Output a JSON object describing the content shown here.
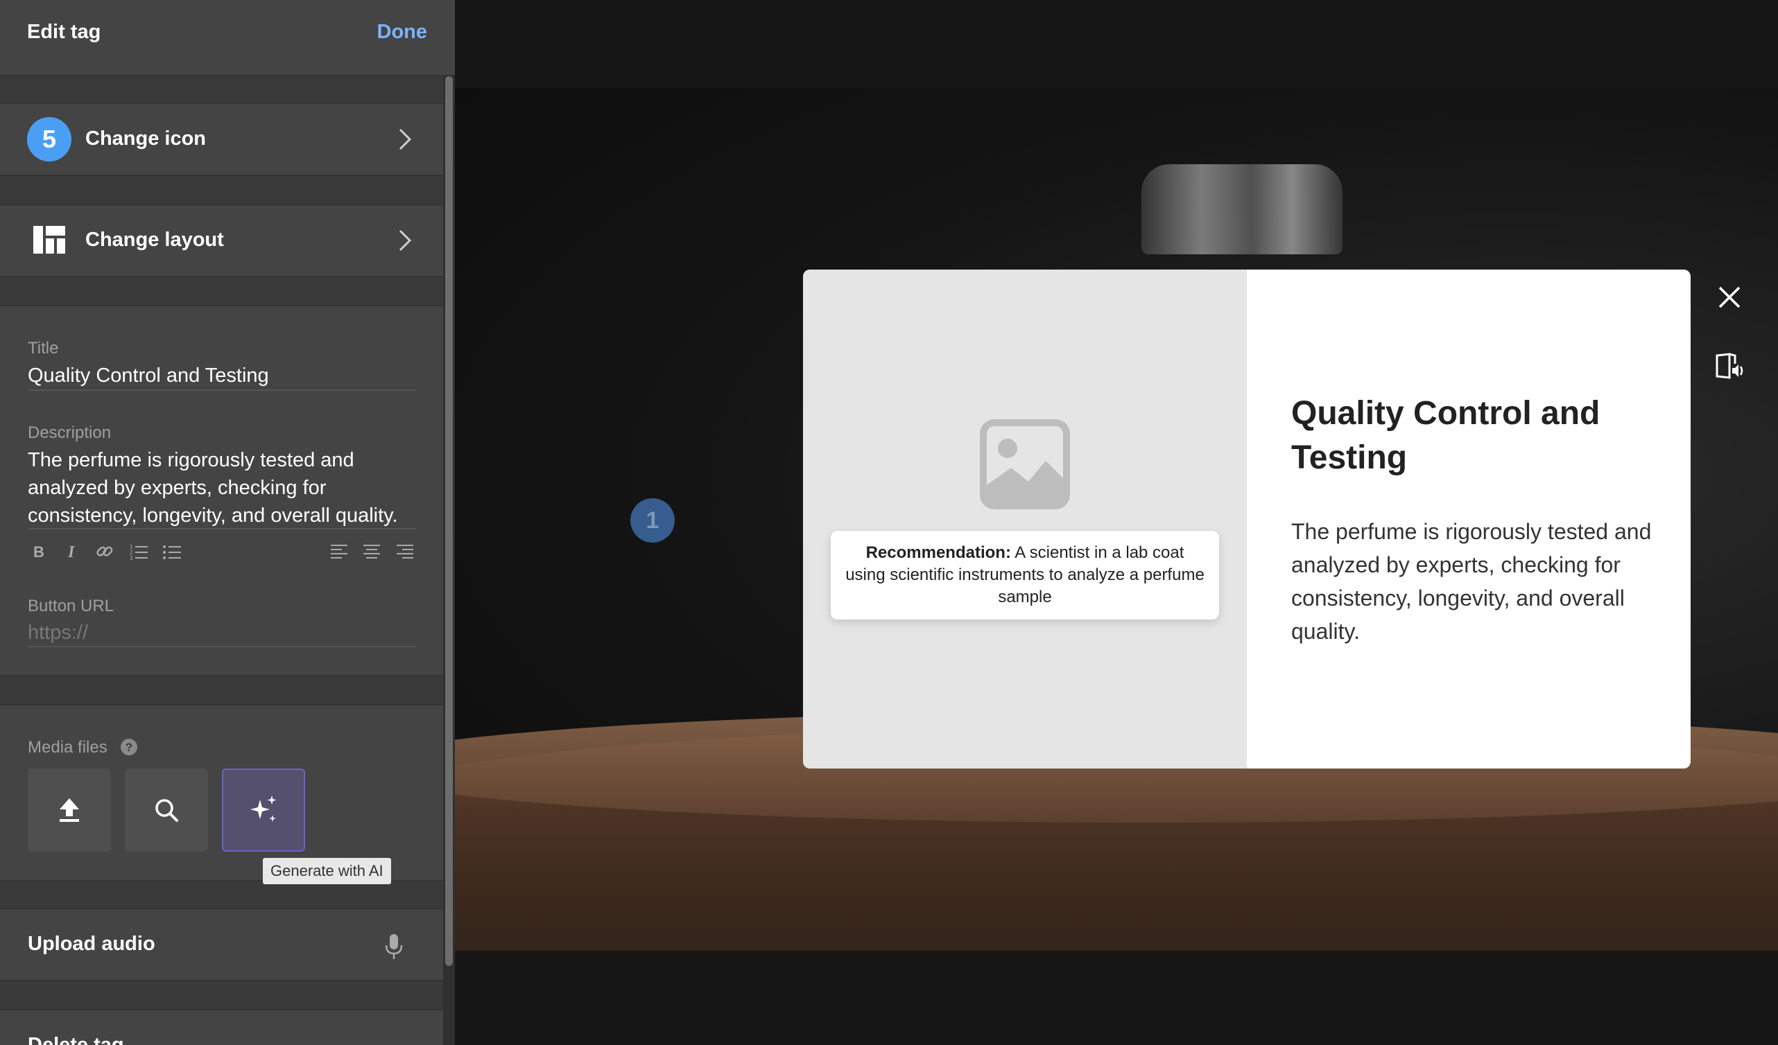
{
  "sidebar": {
    "header": {
      "title": "Edit tag",
      "done_label": "Done"
    },
    "change_icon": {
      "badge": "5",
      "label": "Change icon"
    },
    "change_layout": {
      "label": "Change layout"
    },
    "title_field": {
      "label": "Title",
      "value": "Quality Control and Testing"
    },
    "description_field": {
      "label": "Description",
      "value": "The perfume is rigorously tested and analyzed by experts, checking for consistency, longevity, and overall quality."
    },
    "formatting_toolbar": [
      "bold-icon",
      "italic-icon",
      "link-icon",
      "ordered-list-icon",
      "bullet-list-icon",
      "align-left-icon",
      "align-center-icon",
      "align-right-icon"
    ],
    "button_url_field": {
      "label": "Button URL",
      "placeholder": "https://"
    },
    "media_files": {
      "label": "Media files",
      "buttons": [
        "upload-icon",
        "search-icon",
        "sparkles-icon"
      ],
      "tooltip": "Generate with AI"
    },
    "upload_audio": {
      "label": "Upload audio"
    },
    "delete_tag": {
      "label": "Delete tag"
    }
  },
  "canvas": {
    "hotspot_number": "1",
    "popup": {
      "recommendation_label": "Recommendation:",
      "recommendation_text": " A scientist in a lab coat using scientific instruments to analyze a perfume sample",
      "title": "Quality Control and Testing",
      "description": "The perfume is rigorously tested and analyzed by experts, checking for consistency, longevity, and overall quality."
    }
  },
  "colors": {
    "accent_blue": "#4a9ff5",
    "done_link": "#7cb3ff",
    "ai_button_border": "#6b63c9"
  }
}
